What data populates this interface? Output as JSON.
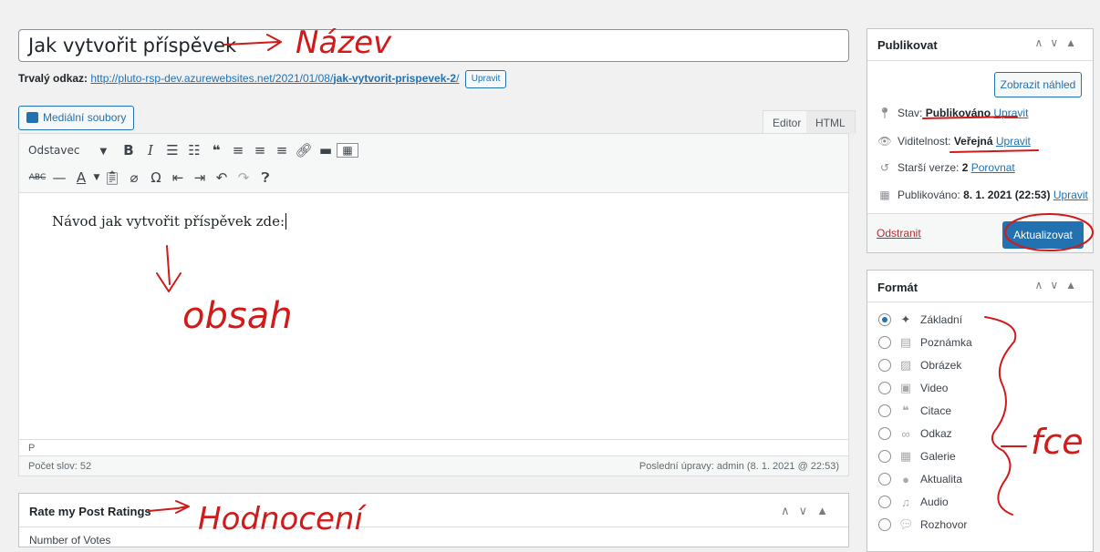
{
  "editor": {
    "title": "Jak vytvořit příspěvek",
    "permalink_label": "Trvalý odkaz:",
    "permalink_base": "http://pluto-rsp-dev.azurewebsites.net/2021/01/08/",
    "permalink_slug": "jak-vytvorit-prispevek-2",
    "permalink_trail": "/",
    "permalink_edit": "Upravit",
    "media_button": "Mediální soubory",
    "tab_visual": "Editor",
    "tab_html": "HTML",
    "format_select": "Odstavec",
    "content": "Návod jak vytvořit příspěvek zde:",
    "path": "P",
    "word_count": "Počet slov: 52",
    "last_edit": "Poslední úpravy: admin (8. 1. 2021 @ 22:53)"
  },
  "rate_box": {
    "title": "Rate my Post Ratings",
    "votes_label": "Number of Votes"
  },
  "publish_box": {
    "title": "Publikovat",
    "preview_button": "Zobrazit náhled",
    "status_label": "Stav:",
    "status_value": "Publikováno",
    "visibility_label": "Viditelnost:",
    "visibility_value": "Veřejná",
    "revisions_label": "Starší verze:",
    "revisions_value": "2",
    "compare_link": "Porovnat",
    "published_label": "Publikováno:",
    "published_value": "8. 1. 2021 (22:53)",
    "edit_link": "Upravit",
    "delete_link": "Odstranit",
    "update_button": "Aktualizovat"
  },
  "format_box": {
    "title": "Formát",
    "items": [
      {
        "label": "Základní",
        "icon": "pin-icon",
        "checked": true
      },
      {
        "label": "Poznámka",
        "icon": "aside-icon"
      },
      {
        "label": "Obrázek",
        "icon": "image-icon"
      },
      {
        "label": "Video",
        "icon": "video-icon"
      },
      {
        "label": "Citace",
        "icon": "quote-icon"
      },
      {
        "label": "Odkaz",
        "icon": "link-icon"
      },
      {
        "label": "Galerie",
        "icon": "gallery-icon"
      },
      {
        "label": "Aktualita",
        "icon": "status-icon"
      },
      {
        "label": "Audio",
        "icon": "audio-icon"
      },
      {
        "label": "Rozhovor",
        "icon": "chat-icon"
      }
    ]
  },
  "annotations": {
    "title_note": "Název",
    "content_note": "obsah",
    "rating_note": "Hodnocení",
    "format_note": "fce"
  },
  "colors": {
    "accent": "#2271b1",
    "annotation": "#d11a1a",
    "delete": "#b32d2e"
  }
}
